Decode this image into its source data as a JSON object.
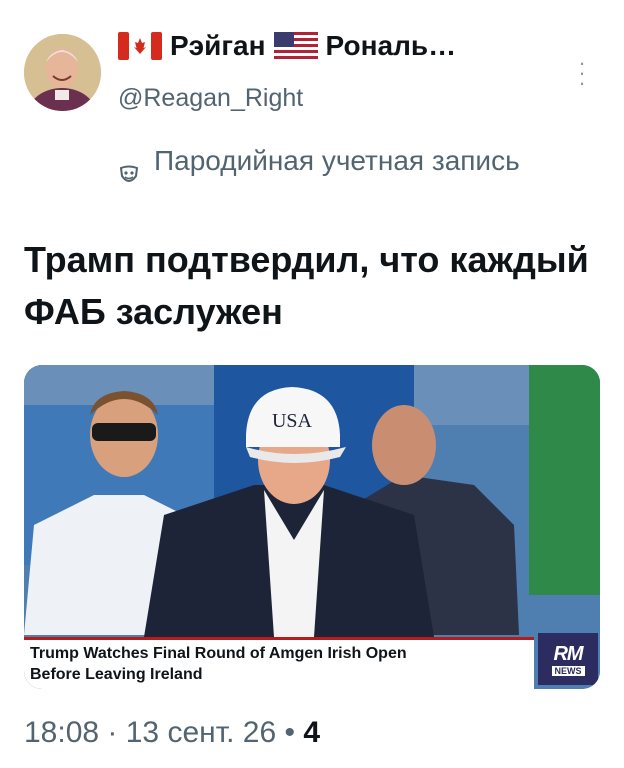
{
  "header": {
    "display_name_left": "Рэйган",
    "display_name_right": "Рональ…",
    "left_flag": "canada-flag",
    "middle_flag": "usa-flag",
    "handle": "@Reagan_Right",
    "more_icon": "more-vertical-icon"
  },
  "parody": {
    "icon": "theater-mask-icon",
    "label": "Пародийная учетная запись"
  },
  "tweet": {
    "text": "Трамп подтвердил, что каждый ФАБ заслужен"
  },
  "media": {
    "cap_text": "USA",
    "caption_line1": "Trump Watches Final Round of Amgen Irish Open",
    "caption_line2": "Before Leaving Ireland",
    "logo_icon": "rm-news-logo",
    "logo_text": "NEWS"
  },
  "meta": {
    "time": "18:08",
    "date": "13 сент. 26",
    "views": "4"
  }
}
